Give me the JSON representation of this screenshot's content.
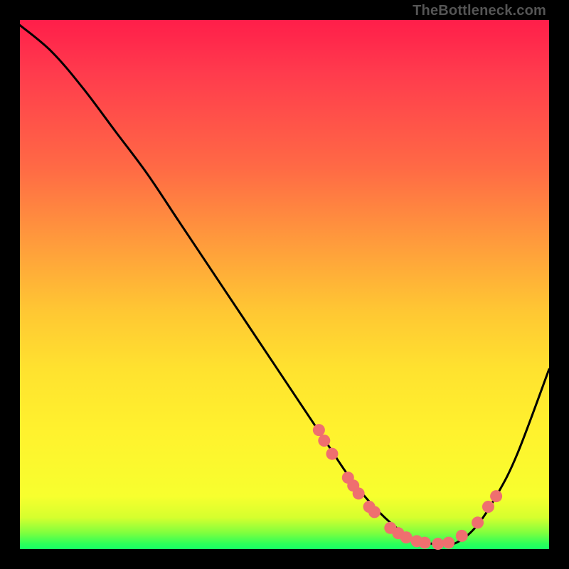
{
  "watermark": "TheBottleneck.com",
  "colors": {
    "dot": "#ef6f6f",
    "curve": "#000000",
    "frame_bg": "#000000"
  },
  "chart_data": {
    "type": "line",
    "title": "",
    "xlabel": "",
    "ylabel": "",
    "xlim": [
      0,
      100
    ],
    "ylim": [
      0,
      100
    ],
    "grid": false,
    "legend": false,
    "series": [
      {
        "name": "bottleneck-curve",
        "x": [
          0,
          6,
          12,
          18,
          24,
          30,
          36,
          42,
          48,
          54,
          58,
          62,
          66,
          70,
          74,
          78,
          82,
          86,
          90,
          94,
          100
        ],
        "y": [
          99,
          94,
          87,
          79,
          71,
          62,
          53,
          44,
          35,
          26,
          20,
          14,
          9,
          5,
          2,
          1,
          1,
          4,
          10,
          18,
          34
        ]
      }
    ],
    "markers": [
      {
        "x": 56.5,
        "y": 22.5
      },
      {
        "x": 57.5,
        "y": 20.5
      },
      {
        "x": 59.0,
        "y": 18.0
      },
      {
        "x": 62.0,
        "y": 13.5
      },
      {
        "x": 63.0,
        "y": 12.0
      },
      {
        "x": 64.0,
        "y": 10.5
      },
      {
        "x": 66.0,
        "y": 8.0
      },
      {
        "x": 67.0,
        "y": 7.0
      },
      {
        "x": 70.0,
        "y": 4.0
      },
      {
        "x": 71.5,
        "y": 3.0
      },
      {
        "x": 73.0,
        "y": 2.2
      },
      {
        "x": 75.0,
        "y": 1.5
      },
      {
        "x": 76.5,
        "y": 1.2
      },
      {
        "x": 79.0,
        "y": 1.0
      },
      {
        "x": 81.0,
        "y": 1.2
      },
      {
        "x": 83.5,
        "y": 2.5
      },
      {
        "x": 86.5,
        "y": 5.0
      },
      {
        "x": 88.5,
        "y": 8.0
      },
      {
        "x": 90.0,
        "y": 10.0
      }
    ]
  }
}
